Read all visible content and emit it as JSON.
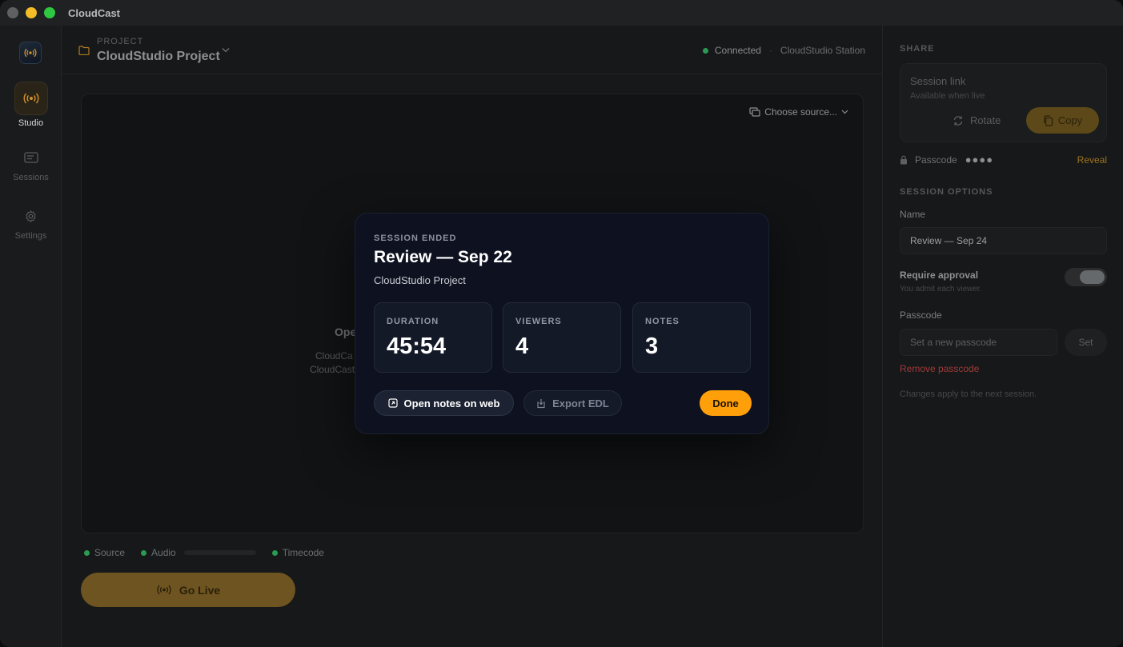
{
  "app": {
    "title": "CloudCast"
  },
  "sidebar": {
    "items": [
      {
        "label": "Studio",
        "icon": "broadcast-icon",
        "active": true
      },
      {
        "label": "Sessions",
        "icon": "sessions-icon",
        "active": false
      },
      {
        "label": "Settings",
        "icon": "gear-icon",
        "active": false
      }
    ]
  },
  "header": {
    "project_eyebrow": "PROJECT",
    "project_name": "CloudStudio Project",
    "connection_status": "Connected",
    "separator": "·",
    "station_name": "CloudStudio Station"
  },
  "preview": {
    "source_label": "Choose source...",
    "title_fragment": "Ope",
    "line1_fragment": "CloudCa",
    "line2_fragment": "CloudCast"
  },
  "indicators": {
    "source": "Source",
    "audio": "Audio",
    "timecode": "Timecode"
  },
  "go_live": {
    "label": "Go Live"
  },
  "share": {
    "section_title": "SHARE",
    "session_link_title": "Session link",
    "session_link_sub": "Available when live",
    "rotate_label": "Rotate",
    "copy_label": "Copy",
    "passcode_label": "Passcode",
    "passcode_mask": "●●●●",
    "reveal_label": "Reveal"
  },
  "session_options": {
    "section_title": "SESSION OPTIONS",
    "name_label": "Name",
    "name_value": "Review — Sep 24",
    "approval_title": "Require approval",
    "approval_sub": "You admit each viewer.",
    "approval_on": true,
    "passcode_label": "Passcode",
    "passcode_placeholder": "Set a new passcode",
    "set_label": "Set",
    "remove_label": "Remove passcode",
    "note": "Changes apply to the next session."
  },
  "modal": {
    "eyebrow": "SESSION ENDED",
    "title": "Review — Sep 22",
    "subtitle": "CloudStudio Project",
    "stats": [
      {
        "label": "DURATION",
        "value": "45:54"
      },
      {
        "label": "VIEWERS",
        "value": "4"
      },
      {
        "label": "NOTES",
        "value": "3"
      }
    ],
    "open_notes_label": "Open notes on web",
    "export_label": "Export EDL",
    "done_label": "Done"
  },
  "colors": {
    "accent": "#ff9f0a",
    "connected": "#2b9a52",
    "danger": "#a03a3a"
  }
}
